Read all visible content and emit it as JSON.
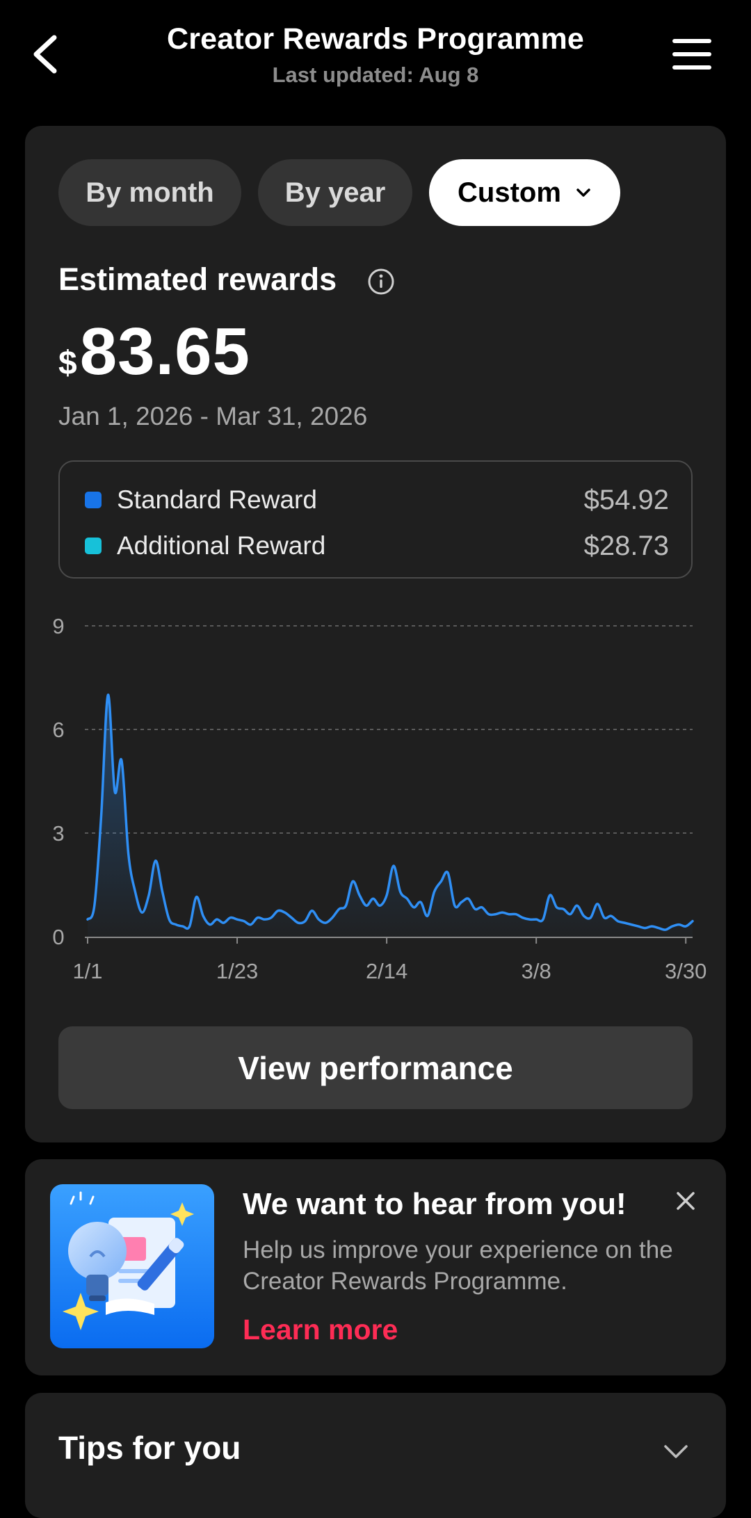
{
  "header": {
    "title": "Creator Rewards Programme",
    "subtitle": "Last updated: Aug 8"
  },
  "tabs": [
    {
      "label": "By month"
    },
    {
      "label": "By year"
    },
    {
      "label": "Custom",
      "active": true
    }
  ],
  "rewards": {
    "label": "Estimated rewards",
    "currency": "$",
    "amount": "83.65",
    "date_range": "Jan 1, 2026 - Mar 31, 2026"
  },
  "legend": [
    {
      "name": "Standard Reward",
      "value": "$54.92",
      "color": "#1874e8"
    },
    {
      "name": "Additional Reward",
      "value": "$28.73",
      "color": "#17c1d9"
    }
  ],
  "chart_data": {
    "type": "line",
    "x": [
      "1/1",
      "1/2",
      "1/3",
      "1/4",
      "1/5",
      "1/6",
      "1/7",
      "1/8",
      "1/9",
      "1/10",
      "1/11",
      "1/12",
      "1/13",
      "1/14",
      "1/15",
      "1/16",
      "1/17",
      "1/18",
      "1/19",
      "1/20",
      "1/21",
      "1/22",
      "1/23",
      "1/24",
      "1/25",
      "1/26",
      "1/27",
      "1/28",
      "1/29",
      "1/30",
      "1/31",
      "2/1",
      "2/2",
      "2/3",
      "2/4",
      "2/5",
      "2/6",
      "2/7",
      "2/8",
      "2/9",
      "2/10",
      "2/11",
      "2/12",
      "2/13",
      "2/14",
      "2/15",
      "2/16",
      "2/17",
      "2/18",
      "2/19",
      "2/20",
      "2/21",
      "2/22",
      "2/23",
      "2/24",
      "2/25",
      "2/26",
      "2/27",
      "2/28",
      "3/1",
      "3/2",
      "3/3",
      "3/4",
      "3/5",
      "3/6",
      "3/7",
      "3/8",
      "3/9",
      "3/10",
      "3/11",
      "3/12",
      "3/13",
      "3/14",
      "3/15",
      "3/16",
      "3/17",
      "3/18",
      "3/19",
      "3/20",
      "3/21",
      "3/22",
      "3/23",
      "3/24",
      "3/25",
      "3/26",
      "3/27",
      "3/28",
      "3/29",
      "3/30",
      "3/31"
    ],
    "series": [
      {
        "color": "#2f8ff5",
        "values": [
          0.5,
          0.9,
          3.5,
          7.0,
          4.2,
          5.1,
          2.4,
          1.3,
          0.7,
          1.2,
          2.2,
          1.3,
          0.5,
          0.35,
          0.3,
          0.3,
          1.15,
          0.6,
          0.35,
          0.5,
          0.4,
          0.55,
          0.5,
          0.45,
          0.35,
          0.55,
          0.5,
          0.55,
          0.75,
          0.7,
          0.55,
          0.4,
          0.45,
          0.75,
          0.5,
          0.4,
          0.55,
          0.8,
          0.9,
          1.6,
          1.2,
          0.9,
          1.1,
          0.9,
          1.2,
          2.05,
          1.3,
          1.1,
          0.85,
          1.0,
          0.6,
          1.3,
          1.6,
          1.85,
          0.9,
          1.0,
          1.1,
          0.8,
          0.85,
          0.65,
          0.65,
          0.7,
          0.65,
          0.65,
          0.55,
          0.5,
          0.5,
          0.5,
          1.2,
          0.85,
          0.8,
          0.65,
          0.9,
          0.6,
          0.55,
          0.95,
          0.55,
          0.6,
          0.45,
          0.4,
          0.35,
          0.3,
          0.25,
          0.3,
          0.25,
          0.2,
          0.3,
          0.35,
          0.3,
          0.45
        ]
      }
    ],
    "y_ticks": [
      0,
      3,
      6,
      9
    ],
    "x_ticks": [
      "1/1",
      "1/23",
      "2/14",
      "3/8",
      "3/30"
    ],
    "ylim": [
      0,
      9
    ],
    "grid": true
  },
  "view_button": {
    "label": "View performance"
  },
  "feedback": {
    "title": "We want to hear from you!",
    "body": "Help us improve your experience on the Creator Rewards Programme.",
    "link": "Learn more"
  },
  "tips": {
    "title": "Tips for you"
  }
}
